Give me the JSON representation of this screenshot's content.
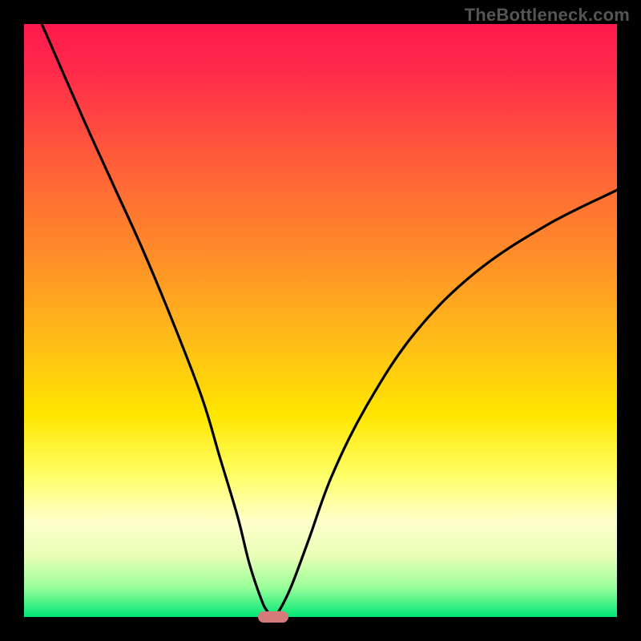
{
  "watermark": "TheBottleneck.com",
  "colors": {
    "frame": "#000000",
    "curve": "#000000",
    "marker": "#d47a7a"
  },
  "chart_data": {
    "type": "line",
    "title": "",
    "xlabel": "",
    "ylabel": "",
    "xlim": [
      0,
      100
    ],
    "ylim": [
      0,
      100
    ],
    "grid": false,
    "legend": false,
    "series": [
      {
        "name": "bottleneck-curve",
        "x": [
          3,
          10,
          15,
          20,
          25,
          30,
          33,
          36,
          38,
          40,
          41,
          42,
          43,
          45,
          48,
          52,
          58,
          66,
          76,
          88,
          100
        ],
        "y": [
          100,
          84,
          73,
          62,
          50,
          37,
          27,
          17,
          9,
          3,
          1,
          0,
          1,
          5,
          13,
          24,
          36,
          48,
          58,
          66,
          72
        ]
      }
    ],
    "annotations": [
      {
        "type": "marker",
        "shape": "pill",
        "x": 42,
        "y": 0,
        "color": "#d47a7a"
      }
    ],
    "background_gradient": {
      "direction": "top-to-bottom",
      "stops": [
        {
          "pos": 0,
          "color": "#ff1a4d"
        },
        {
          "pos": 22,
          "color": "#ff5a3a"
        },
        {
          "pos": 52,
          "color": "#ffb81a"
        },
        {
          "pos": 76,
          "color": "#ffff66"
        },
        {
          "pos": 95,
          "color": "#99ff99"
        },
        {
          "pos": 100,
          "color": "#00e676"
        }
      ]
    }
  }
}
